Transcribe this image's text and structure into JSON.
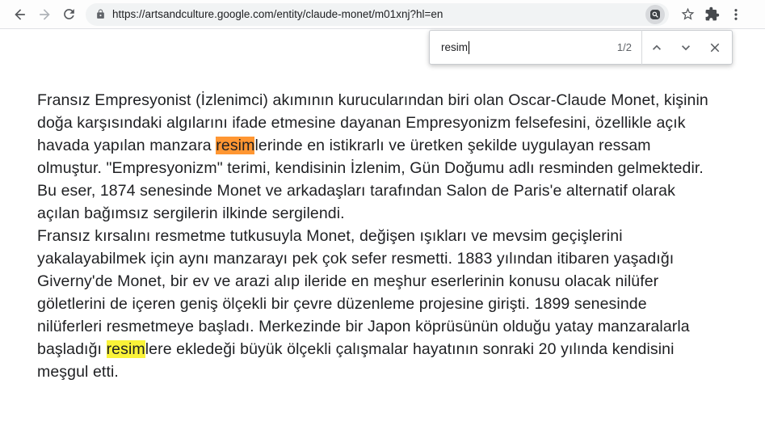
{
  "browser": {
    "url": "https://artsandculture.google.com/entity/claude-monet/m01xnj?hl=en",
    "icons": {
      "back": "left-arrow",
      "forward": "right-arrow",
      "reload": "circular-arrow",
      "lock": "padlock",
      "search_image": "magnifier-in-rounded-square",
      "bookmark": "star-outline",
      "extensions": "puzzle-piece",
      "menu": "vertical-kebab-dots"
    }
  },
  "find_bar": {
    "query": "resim",
    "result_counter": "1/2",
    "icons": {
      "previous": "chevron-up",
      "next": "chevron-down",
      "close": "x-mark"
    }
  },
  "colors": {
    "active_match": "#FF9632",
    "other_match": "#FAF338",
    "omnibox_bg": "#F1F3F4",
    "toolbar_icon": "#54575B",
    "url_text": "#202124"
  },
  "content": {
    "lines": [
      [
        {
          "t": "Fransız Empresyonist (İzlenimci) akımının kurucularından biri olan Oscar-Claude Monet, kişinin"
        }
      ],
      [
        {
          "t": "doğa karşısındaki algılarını ifade etmesine dayanan Empresyonizm felsefesini, özellikle açık"
        }
      ],
      [
        {
          "t": "havada yapılan manzara "
        },
        {
          "t": "resim",
          "h": "active"
        },
        {
          "t": "lerinde en istikrarlı ve üretken şekilde uygulayan ressam"
        }
      ],
      [
        {
          "t": "olmuştur. \"Empresyonizm\" terimi, kendisinin İzlenim, Gün Doğumu adlı resminden gelmektedir."
        }
      ],
      [
        {
          "t": "Bu eser, 1874 senesinde Monet ve arkadaşları tarafından Salon de Paris'e alternatif olarak"
        }
      ],
      [
        {
          "t": "açılan bağımsız sergilerin ilkinde sergilendi."
        }
      ],
      [
        {
          "t": "Fransız kırsalını resmetme tutkusuyla Monet, değişen ışıkları ve mevsim geçişlerini"
        }
      ],
      [
        {
          "t": "yakalayabilmek için aynı manzarayı pek çok sefer resmetti. 1883 yılından itibaren yaşadığı"
        }
      ],
      [
        {
          "t": "Giverny'de Monet, bir ev ve arazi alıp ileride en meşhur eserlerinin konusu olacak nilüfer"
        }
      ],
      [
        {
          "t": "göletlerini de içeren geniş ölçekli bir çevre düzenleme projesine girişti. 1899 senesinde"
        }
      ],
      [
        {
          "t": "nilüferleri resmetmeye başladı. Merkezinde bir Japon köprüsünün olduğu yatay manzaralarla"
        }
      ],
      [
        {
          "t": "başladığı "
        },
        {
          "t": "resim",
          "h": "match"
        },
        {
          "t": "lere ekledeği büyük ölçekli çalışmalar hayatının sonraki 20 yılında kendisini"
        }
      ],
      [
        {
          "t": "meşgul etti."
        }
      ]
    ]
  }
}
